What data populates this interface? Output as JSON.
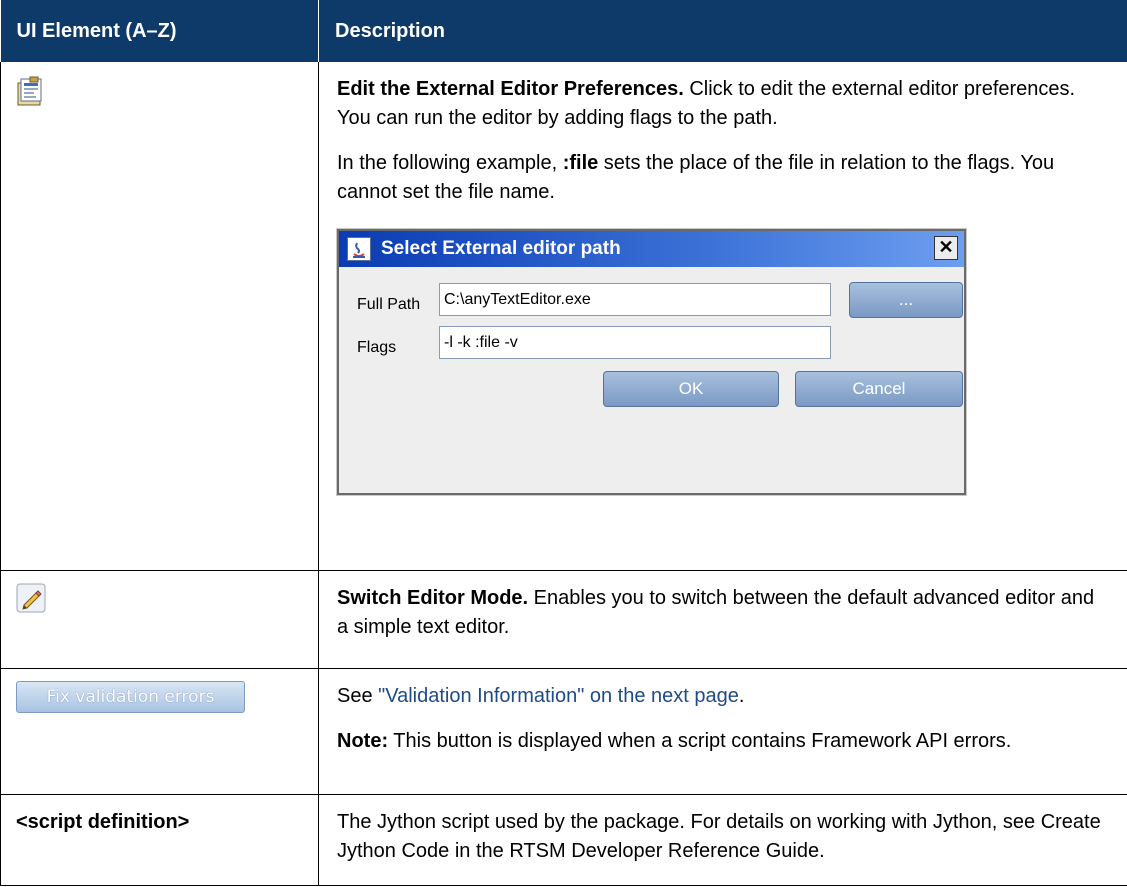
{
  "table": {
    "col1_header": "UI Element (A–Z)",
    "col2_header": "Description"
  },
  "rows": {
    "edit_prefs": {
      "icon": "edit-preferences-icon",
      "title": "Edit the External Editor Preferences.",
      "text": " Click to edit the external editor preferences. You can run the editor by adding flags to the path.",
      "para2_before": "In the following example, ",
      "para2_bold": ":file",
      "para2_after": " sets the place of the file in relation to the flags. You cannot set the file name."
    },
    "switch_mode": {
      "icon": "pencil-icon",
      "title": "Switch Editor Mode.",
      "text": " Enables you to switch between the default advanced editor and a simple text editor."
    },
    "fix_validation": {
      "button_label": "Fix validation errors",
      "see_prefix": "See ",
      "see_link": "\"Validation Information\" on the next page",
      "see_suffix": ".",
      "note_label": "Note:",
      "note_text": " This button is displayed when a script contains Framework API errors."
    },
    "script_def": {
      "element": "<script definition>",
      "text": "The Jython script used by the package. For details on working with Jython, see Create Jython Code in the RTSM Developer Reference Guide."
    }
  },
  "dialog": {
    "title": "Select External editor path",
    "close": "✕",
    "full_path_label": "Full Path",
    "full_path_value": "C:\\anyTextEditor.exe",
    "browse_label": "...",
    "flags_label": "Flags",
    "flags_value": "-l -k :file -v",
    "ok_label": "OK",
    "cancel_label": "Cancel"
  }
}
